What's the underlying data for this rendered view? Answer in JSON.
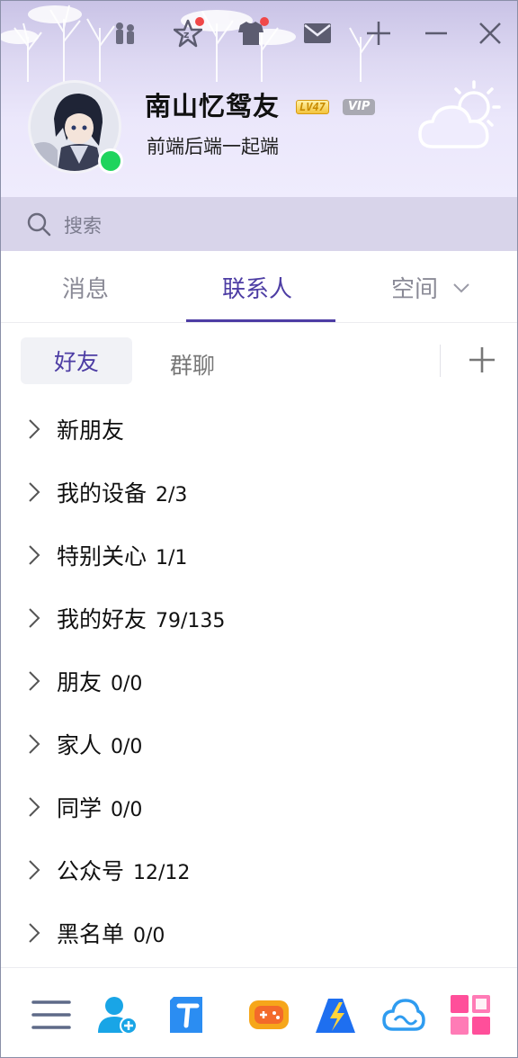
{
  "profile": {
    "nickname": "南山忆鸳友",
    "level_badge": "LV47",
    "vip_badge": "VIP",
    "signature": "前端后端一起端",
    "status": "online"
  },
  "top_icons": [
    "qzone-icon",
    "skin-icon",
    "mail-icon",
    "add-window-icon",
    "minimize-icon",
    "close-icon"
  ],
  "search": {
    "placeholder": "搜索"
  },
  "main_tabs": [
    {
      "label": "消息",
      "active": false
    },
    {
      "label": "联系人",
      "active": true
    },
    {
      "label": "空间",
      "active": false
    }
  ],
  "sub_tabs": [
    {
      "label": "好友",
      "active": true
    },
    {
      "label": "群聊",
      "active": false
    }
  ],
  "groups": [
    {
      "name": "新朋友",
      "count": ""
    },
    {
      "name": "我的设备",
      "count": "2/3"
    },
    {
      "name": "特别关心",
      "count": "1/1"
    },
    {
      "name": "我的好友",
      "count": "79/135"
    },
    {
      "name": "朋友",
      "count": "0/0"
    },
    {
      "name": "家人",
      "count": "0/0"
    },
    {
      "name": "同学",
      "count": "0/0"
    },
    {
      "name": "公众号",
      "count": "12/12"
    },
    {
      "name": "黑名单",
      "count": "0/0"
    }
  ],
  "bottom_icons": [
    "menu-icon",
    "add-friend-icon",
    "tencent-docs-icon",
    "game-icon",
    "mail-app-icon",
    "weiyun-cloud-icon",
    "apps-grid-icon"
  ],
  "colors": {
    "accent": "#4d3da4",
    "online": "#1fd45d",
    "header_bg": "#ebe7fb",
    "search_bg": "#d8d4ea",
    "notification": "#f04848"
  }
}
